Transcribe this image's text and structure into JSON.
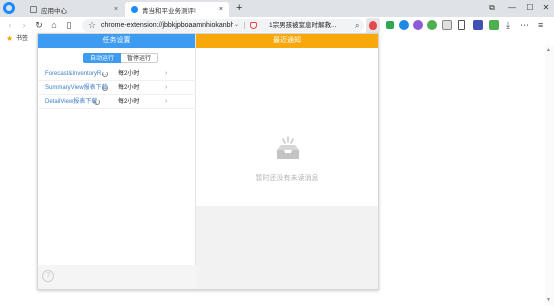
{
  "tabs": [
    {
      "label": "应用中心",
      "active": false
    },
    {
      "label": "青当和平业务测评!",
      "active": true
    }
  ],
  "address": {
    "url": "chrome-extension://jbbkjpboaamnhiokanbhgdjfkaiq",
    "hot_search": "1宗男孩被窒息时解救..."
  },
  "bookmarks": [
    {
      "label": "书签"
    }
  ],
  "popup": {
    "left_header": "任务设置",
    "right_header": "最近通知",
    "buttons": {
      "primary": "自动运行",
      "secondary": "暂停运行"
    },
    "tasks": [
      {
        "name": "Forecast&InventoryR...",
        "time": "每2小时"
      },
      {
        "name": "SummaryView报表下载",
        "time": "每2小时"
      },
      {
        "name": "DetailView报表下载",
        "time": "每2小时"
      }
    ],
    "empty_message": "暂时还没有未读消息"
  },
  "colors": {
    "blue_header": "#3d9bf0",
    "orange_header": "#f7a90b",
    "ext_active": "#e8474b"
  },
  "icons": {
    "help": "?",
    "close": "×",
    "new_tab": "+"
  }
}
